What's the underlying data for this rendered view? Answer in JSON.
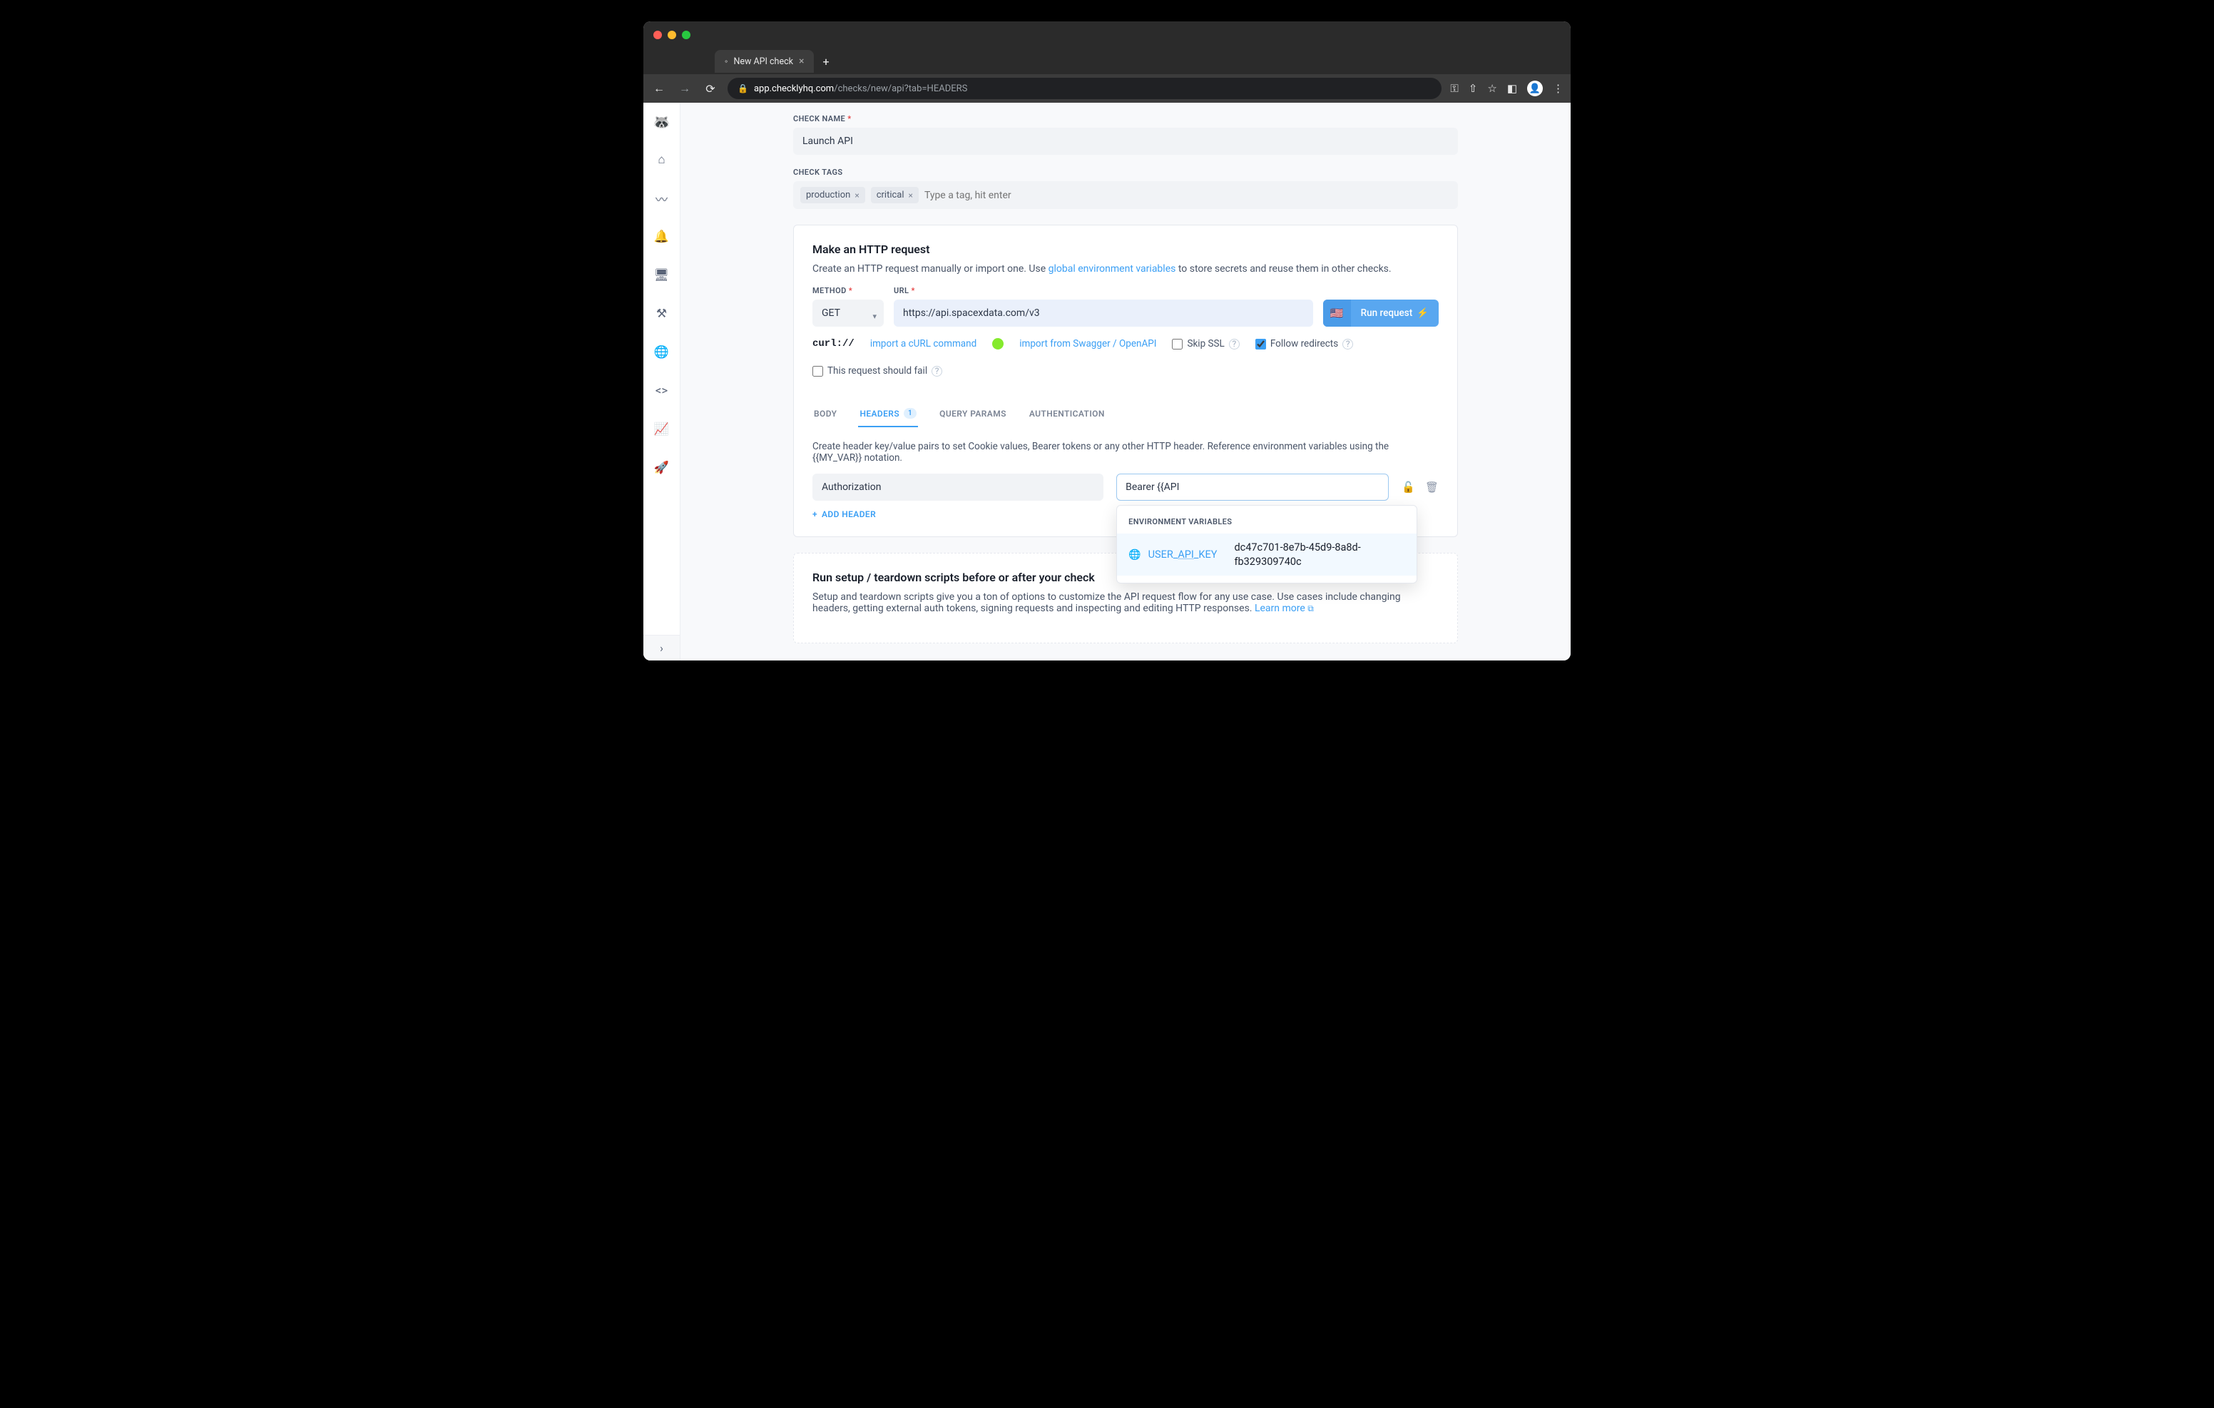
{
  "browser": {
    "tab_title": "New API check",
    "url_host": "app.checklyhq.com",
    "url_path": "/checks/new/api?tab=HEADERS"
  },
  "form": {
    "check_name_label": "CHECK NAME",
    "check_name_value": "Launch API",
    "check_tags_label": "CHECK TAGS",
    "tags": [
      "production",
      "critical"
    ],
    "tags_placeholder": "Type a tag, hit enter"
  },
  "http": {
    "title": "Make an HTTP request",
    "desc_pre": "Create an HTTP request manually or import one. Use ",
    "desc_link": "global environment variables",
    "desc_post": " to store secrets and reuse them in other checks.",
    "method_label": "METHOD",
    "method_value": "GET",
    "url_label": "URL",
    "url_value": "https://api.spacexdata.com/v3",
    "run_button": "Run request",
    "import_curl": "import a cURL command",
    "import_swagger": "import from Swagger / OpenAPI",
    "skip_ssl": "Skip SSL",
    "follow_redirects": "Follow redirects",
    "should_fail": "This request should fail"
  },
  "tabs": {
    "body": "BODY",
    "headers": "HEADERS",
    "headers_count": "1",
    "query": "QUERY PARAMS",
    "auth": "AUTHENTICATION"
  },
  "headers": {
    "desc": "Create header key/value pairs to set Cookie values, Bearer tokens or any other HTTP header. Reference environment variables using the {{MY_VAR}} notation.",
    "key": "Authorization",
    "value": "Bearer {{API",
    "add_btn": "ADD HEADER"
  },
  "autocomplete": {
    "label": "ENVIRONMENT VARIABLES",
    "var_pre": "USER_",
    "var_hl": "API",
    "var_post": "_KEY",
    "var_value": "dc47c701-8e7b-45d9-8a8d-fb329309740c"
  },
  "scripts": {
    "title": "Run setup / teardown scripts before or after your check",
    "desc": "Setup and teardown scripts give you a ton of options to customize the API request flow for any use case. Use cases include changing headers, getting external auth tokens, signing requests and inspecting and editing HTTP responses. ",
    "learn_more": "Learn more"
  }
}
